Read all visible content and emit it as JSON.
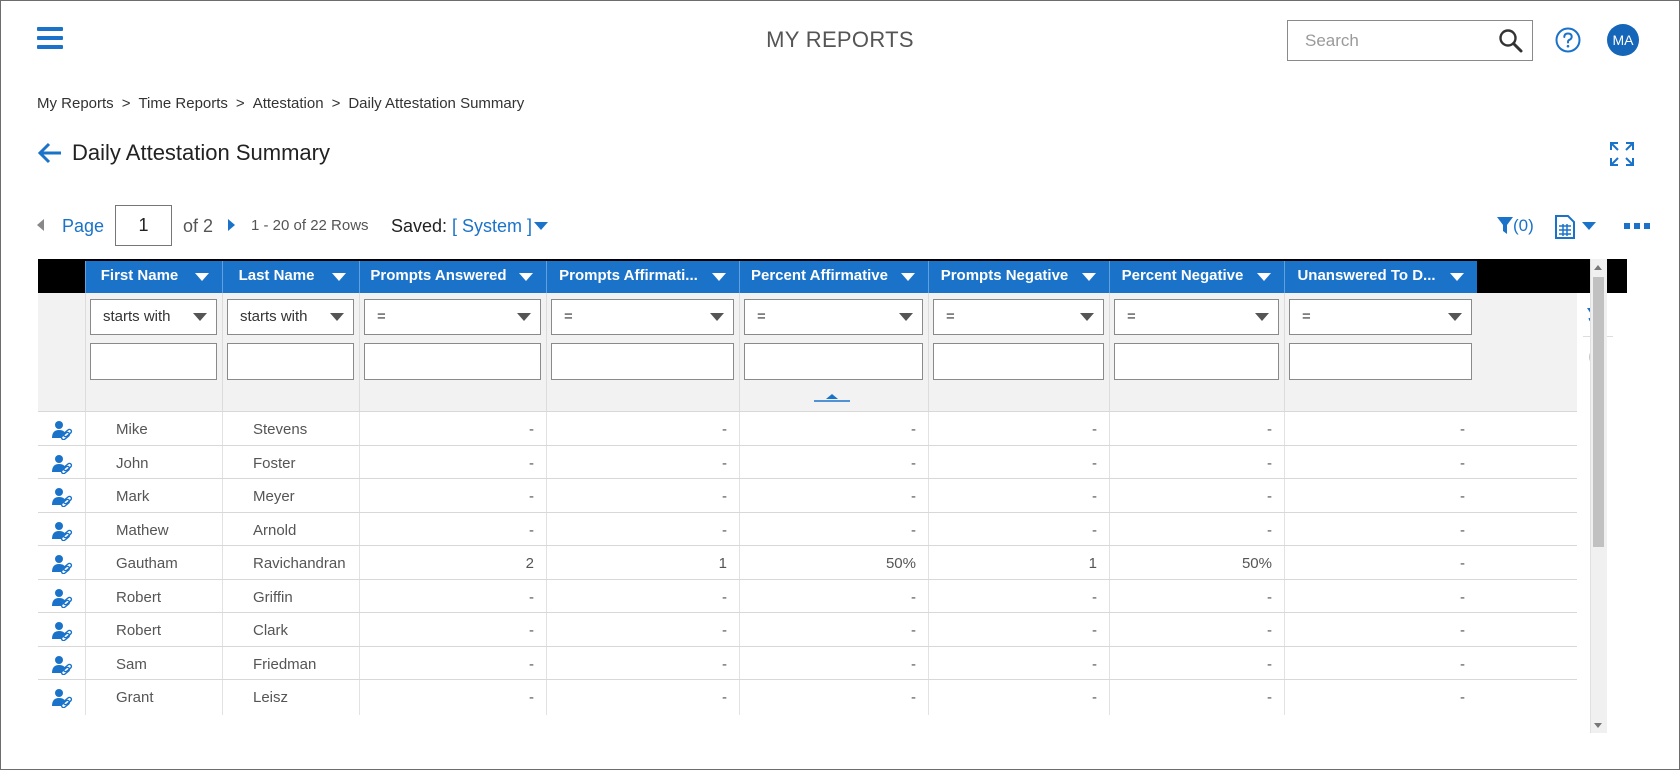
{
  "header": {
    "title": "MY REPORTS",
    "search_placeholder": "Search",
    "avatar_initials": "MA"
  },
  "breadcrumb": [
    "My Reports",
    "Time Reports",
    "Attestation",
    "Daily Attestation Summary"
  ],
  "page_title": "Daily Attestation Summary",
  "pager": {
    "page_label": "Page",
    "page_value": "1",
    "of_label": "of 2",
    "rows_label": "1 - 20 of 22 Rows",
    "saved_label": "Saved:",
    "saved_value": "[ System ]",
    "filter_count": "(0)"
  },
  "columns": [
    {
      "label": "First Name",
      "operator": "starts with"
    },
    {
      "label": "Last Name",
      "operator": "starts with"
    },
    {
      "label": "Prompts Answered",
      "operator": "="
    },
    {
      "label": "Prompts Affirmati...",
      "operator": "="
    },
    {
      "label": "Percent Affirmative",
      "operator": "="
    },
    {
      "label": "Prompts Negative",
      "operator": "="
    },
    {
      "label": "Percent Negative",
      "operator": "="
    },
    {
      "label": "Unanswered To D...",
      "operator": "="
    }
  ],
  "rows": [
    [
      "Mike",
      "Stevens",
      "-",
      "-",
      "-",
      "-",
      "-",
      "-"
    ],
    [
      "John",
      "Foster",
      "-",
      "-",
      "-",
      "-",
      "-",
      "-"
    ],
    [
      "Mark",
      "Meyer",
      "-",
      "-",
      "-",
      "-",
      "-",
      "-"
    ],
    [
      "Mathew",
      "Arnold",
      "-",
      "-",
      "-",
      "-",
      "-",
      "-"
    ],
    [
      "Gautham",
      "Ravichandran",
      "2",
      "1",
      "50%",
      "1",
      "50%",
      "-"
    ],
    [
      "Robert",
      "Griffin",
      "-",
      "-",
      "-",
      "-",
      "-",
      "-"
    ],
    [
      "Robert",
      "Clark",
      "-",
      "-",
      "-",
      "-",
      "-",
      "-"
    ],
    [
      "Sam",
      "Friedman",
      "-",
      "-",
      "-",
      "-",
      "-",
      "-"
    ],
    [
      "Grant",
      "Leisz",
      "-",
      "-",
      "-",
      "-",
      "-",
      "-"
    ]
  ],
  "colors": {
    "accent": "#1a73c9",
    "header_band": "#000000",
    "filter_bg": "#f2f2f2"
  },
  "icons": {
    "menu": "hamburger-icon",
    "search": "search-icon",
    "help": "help-icon",
    "back": "back-arrow-icon",
    "expand": "expand-icon",
    "filter": "filter-icon",
    "export": "export-icon",
    "more": "more-icon",
    "row": "employee-link-icon",
    "reset": "reset-icon",
    "clear": "clear-icon"
  }
}
